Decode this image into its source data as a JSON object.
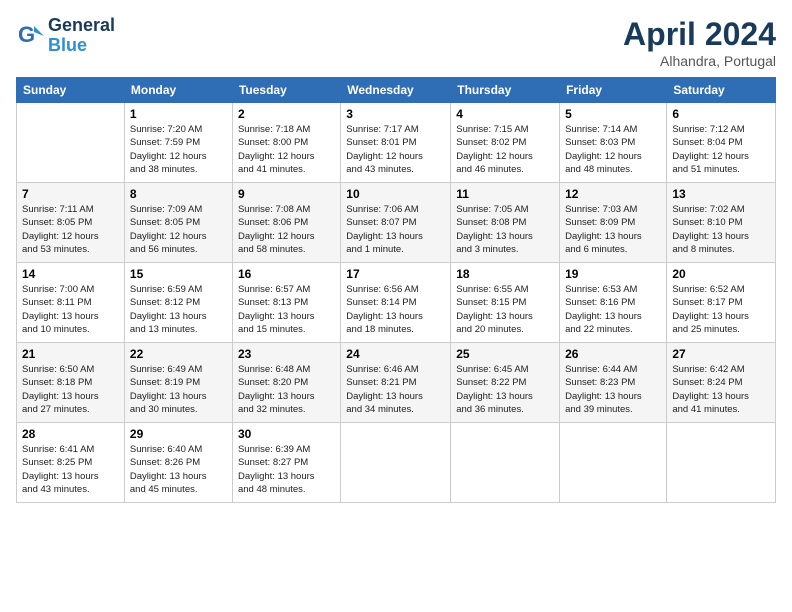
{
  "header": {
    "logo_line1": "General",
    "logo_line2": "Blue",
    "month": "April 2024",
    "location": "Alhandra, Portugal"
  },
  "weekdays": [
    "Sunday",
    "Monday",
    "Tuesday",
    "Wednesday",
    "Thursday",
    "Friday",
    "Saturday"
  ],
  "weeks": [
    [
      {
        "num": "",
        "info": ""
      },
      {
        "num": "1",
        "info": "Sunrise: 7:20 AM\nSunset: 7:59 PM\nDaylight: 12 hours\nand 38 minutes."
      },
      {
        "num": "2",
        "info": "Sunrise: 7:18 AM\nSunset: 8:00 PM\nDaylight: 12 hours\nand 41 minutes."
      },
      {
        "num": "3",
        "info": "Sunrise: 7:17 AM\nSunset: 8:01 PM\nDaylight: 12 hours\nand 43 minutes."
      },
      {
        "num": "4",
        "info": "Sunrise: 7:15 AM\nSunset: 8:02 PM\nDaylight: 12 hours\nand 46 minutes."
      },
      {
        "num": "5",
        "info": "Sunrise: 7:14 AM\nSunset: 8:03 PM\nDaylight: 12 hours\nand 48 minutes."
      },
      {
        "num": "6",
        "info": "Sunrise: 7:12 AM\nSunset: 8:04 PM\nDaylight: 12 hours\nand 51 minutes."
      }
    ],
    [
      {
        "num": "7",
        "info": "Sunrise: 7:11 AM\nSunset: 8:05 PM\nDaylight: 12 hours\nand 53 minutes."
      },
      {
        "num": "8",
        "info": "Sunrise: 7:09 AM\nSunset: 8:05 PM\nDaylight: 12 hours\nand 56 minutes."
      },
      {
        "num": "9",
        "info": "Sunrise: 7:08 AM\nSunset: 8:06 PM\nDaylight: 12 hours\nand 58 minutes."
      },
      {
        "num": "10",
        "info": "Sunrise: 7:06 AM\nSunset: 8:07 PM\nDaylight: 13 hours\nand 1 minute."
      },
      {
        "num": "11",
        "info": "Sunrise: 7:05 AM\nSunset: 8:08 PM\nDaylight: 13 hours\nand 3 minutes."
      },
      {
        "num": "12",
        "info": "Sunrise: 7:03 AM\nSunset: 8:09 PM\nDaylight: 13 hours\nand 6 minutes."
      },
      {
        "num": "13",
        "info": "Sunrise: 7:02 AM\nSunset: 8:10 PM\nDaylight: 13 hours\nand 8 minutes."
      }
    ],
    [
      {
        "num": "14",
        "info": "Sunrise: 7:00 AM\nSunset: 8:11 PM\nDaylight: 13 hours\nand 10 minutes."
      },
      {
        "num": "15",
        "info": "Sunrise: 6:59 AM\nSunset: 8:12 PM\nDaylight: 13 hours\nand 13 minutes."
      },
      {
        "num": "16",
        "info": "Sunrise: 6:57 AM\nSunset: 8:13 PM\nDaylight: 13 hours\nand 15 minutes."
      },
      {
        "num": "17",
        "info": "Sunrise: 6:56 AM\nSunset: 8:14 PM\nDaylight: 13 hours\nand 18 minutes."
      },
      {
        "num": "18",
        "info": "Sunrise: 6:55 AM\nSunset: 8:15 PM\nDaylight: 13 hours\nand 20 minutes."
      },
      {
        "num": "19",
        "info": "Sunrise: 6:53 AM\nSunset: 8:16 PM\nDaylight: 13 hours\nand 22 minutes."
      },
      {
        "num": "20",
        "info": "Sunrise: 6:52 AM\nSunset: 8:17 PM\nDaylight: 13 hours\nand 25 minutes."
      }
    ],
    [
      {
        "num": "21",
        "info": "Sunrise: 6:50 AM\nSunset: 8:18 PM\nDaylight: 13 hours\nand 27 minutes."
      },
      {
        "num": "22",
        "info": "Sunrise: 6:49 AM\nSunset: 8:19 PM\nDaylight: 13 hours\nand 30 minutes."
      },
      {
        "num": "23",
        "info": "Sunrise: 6:48 AM\nSunset: 8:20 PM\nDaylight: 13 hours\nand 32 minutes."
      },
      {
        "num": "24",
        "info": "Sunrise: 6:46 AM\nSunset: 8:21 PM\nDaylight: 13 hours\nand 34 minutes."
      },
      {
        "num": "25",
        "info": "Sunrise: 6:45 AM\nSunset: 8:22 PM\nDaylight: 13 hours\nand 36 minutes."
      },
      {
        "num": "26",
        "info": "Sunrise: 6:44 AM\nSunset: 8:23 PM\nDaylight: 13 hours\nand 39 minutes."
      },
      {
        "num": "27",
        "info": "Sunrise: 6:42 AM\nSunset: 8:24 PM\nDaylight: 13 hours\nand 41 minutes."
      }
    ],
    [
      {
        "num": "28",
        "info": "Sunrise: 6:41 AM\nSunset: 8:25 PM\nDaylight: 13 hours\nand 43 minutes."
      },
      {
        "num": "29",
        "info": "Sunrise: 6:40 AM\nSunset: 8:26 PM\nDaylight: 13 hours\nand 45 minutes."
      },
      {
        "num": "30",
        "info": "Sunrise: 6:39 AM\nSunset: 8:27 PM\nDaylight: 13 hours\nand 48 minutes."
      },
      {
        "num": "",
        "info": ""
      },
      {
        "num": "",
        "info": ""
      },
      {
        "num": "",
        "info": ""
      },
      {
        "num": "",
        "info": ""
      }
    ]
  ]
}
